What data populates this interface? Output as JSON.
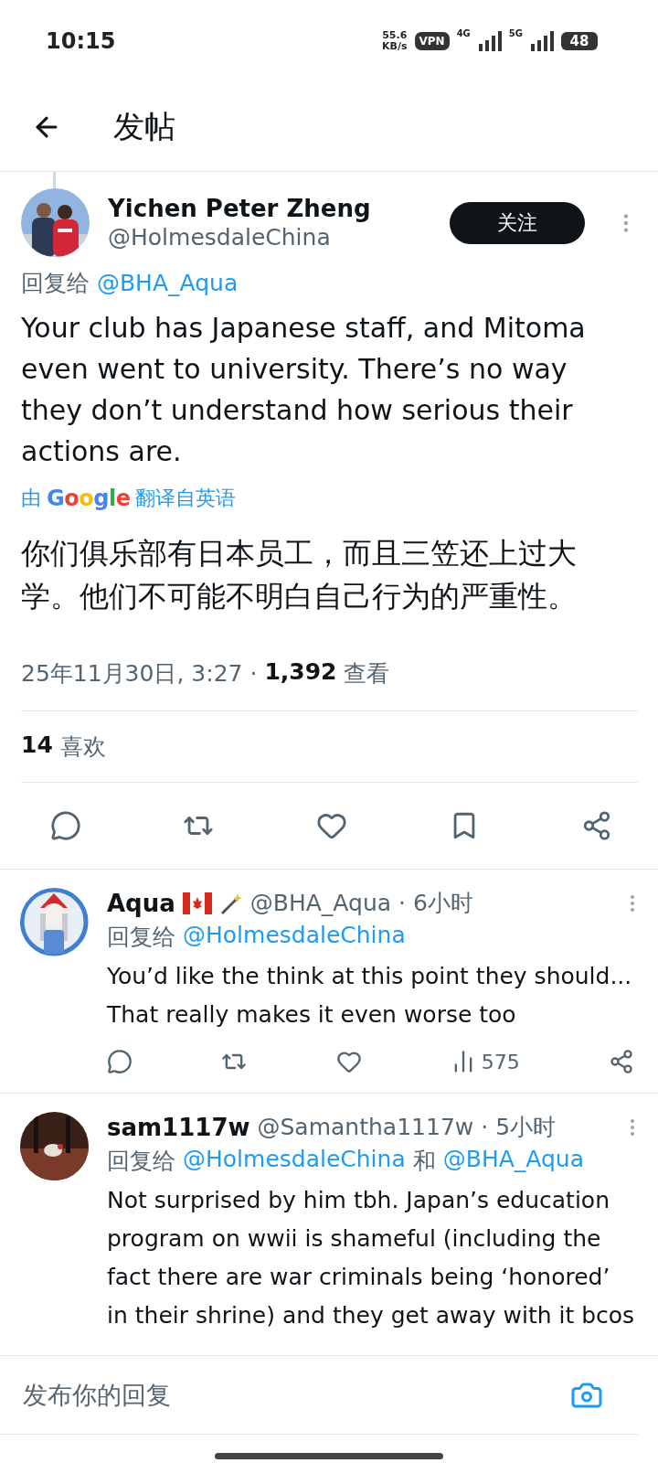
{
  "status_bar": {
    "time": "10:15",
    "speed_value": "55.6",
    "speed_unit": "KB/s",
    "vpn": "VPN",
    "network_1": "4G",
    "network_2": "5G",
    "battery": "48"
  },
  "header": {
    "title": "发帖"
  },
  "post": {
    "author_name": "Yichen Peter Zheng",
    "handle": "@HolmesdaleChina",
    "follow_label": "关注",
    "reply_prefix": "回复给",
    "reply_to": [
      "@BHA_Aqua"
    ],
    "text": "Your club has Japanese staff, and Mitoma even went to university. There’s no way they don’t understand how serious their actions are.",
    "translation": {
      "prefix": "由",
      "brand": "Google",
      "suffix": "翻译自英语"
    },
    "translated_text": "你们俱乐部有日本员工，而且三笠还上过大学。他们不可能不明白自己行为的严重性。",
    "timestamp": "25年11月30日, 3:27 ·",
    "views": "1,392",
    "views_label": "查看",
    "likes": "14",
    "likes_label": "喜欢"
  },
  "replies": [
    {
      "name": "Aqua",
      "name_icons": [
        {
          "kind": "canada-flag"
        },
        {
          "kind": "wand"
        }
      ],
      "handle": "@BHA_Aqua",
      "time": "· 6小时",
      "reply_prefix": "回复给",
      "reply_to": [
        "@HolmesdaleChina"
      ],
      "text": "You’d like the think at this point they should... That really makes it even worse too",
      "show_actions": true,
      "views": "575"
    },
    {
      "name": "sam1117w",
      "handle": "@Samantha1117w",
      "time": "· 5小时",
      "reply_prefix": "回复给",
      "reply_to": [
        "@HolmesdaleChina",
        "@BHA_Aqua"
      ],
      "reply_to_joiner": "和",
      "text": "Not surprised by him tbh. Japan’s education program on wwii is shameful (including the fact there are war criminals being ‘honored’ in their shrine) and they get away with it bcos",
      "show_actions": false
    }
  ],
  "composer": {
    "placeholder": "发布你的回复"
  }
}
